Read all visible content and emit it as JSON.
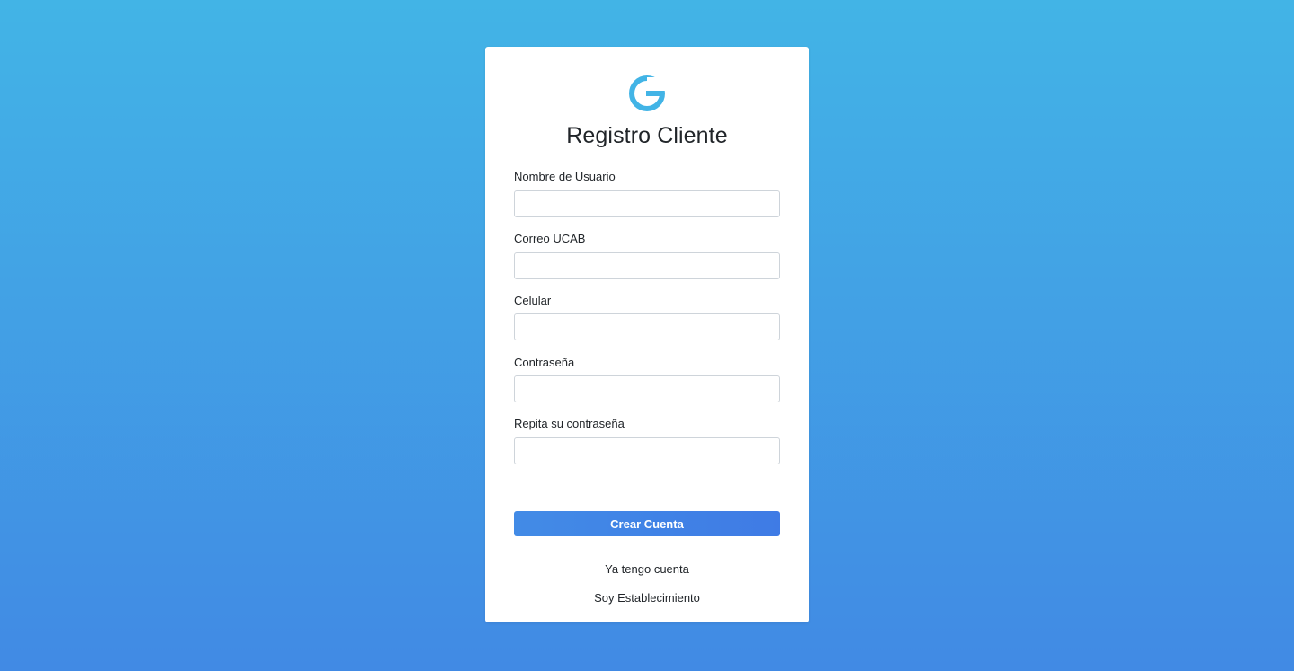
{
  "form": {
    "logo_icon": "g-logo-icon",
    "logo_color": "#42b4e6",
    "title": "Registro Cliente",
    "fields": [
      {
        "label": "Nombre de Usuario",
        "value": "",
        "type": "text"
      },
      {
        "label": "Correo UCAB",
        "value": "",
        "type": "email"
      },
      {
        "label": "Celular",
        "value": "",
        "type": "tel"
      },
      {
        "label": "Contraseña",
        "value": "",
        "type": "password"
      },
      {
        "label": "Repita su contraseña",
        "value": "",
        "type": "password"
      }
    ],
    "submit_label": "Crear Cuenta",
    "links": {
      "have_account": "Ya tengo cuenta",
      "establishment": "Soy Establecimiento"
    }
  },
  "colors": {
    "background_top": "#42b4e6",
    "background_bottom": "#418ae4",
    "button": "#4285e6"
  }
}
